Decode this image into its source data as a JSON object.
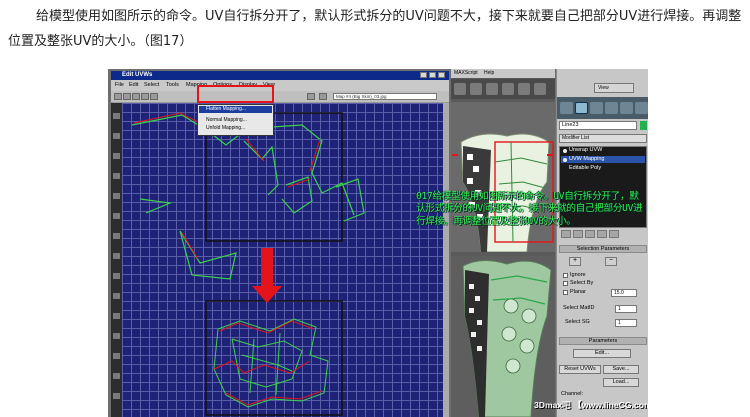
{
  "article": {
    "paragraph": "给模型使用如图所示的命令。UV自行拆分开了，默认形式拆分的UV问题不大，接下来就要自己把部分UV进行焊接。再调整位置及整张UV的大小。（图17）"
  },
  "uv_editor": {
    "title": "Edit UVWs",
    "menu": [
      "File",
      "Edit",
      "Select",
      "Tools",
      "Mapping",
      "Options",
      "Display",
      "View"
    ],
    "map_combo": "Map #4 (Big Skin)_03.jpg",
    "mapping_menu": {
      "items": [
        "Flatten Mapping...",
        "Normal Mapping...",
        "Unfold Mapping..."
      ],
      "selected": "Flatten Mapping..."
    }
  },
  "viewport": {
    "menu": [
      "MAXScript",
      "Help"
    ]
  },
  "command_panel": {
    "view_label": "View",
    "object_name": "Line23",
    "modifier_list": "Modifier List",
    "stack": [
      "Unwrap UVW",
      "UVW Mapping",
      "Editable Poly"
    ],
    "selection_rollout": "Selection Parameters",
    "ignore_label": "Ignore",
    "select_by_label": "Select By",
    "planar_label": "Planar",
    "planar_value": "15.0",
    "select_matid_label": "Select MatID",
    "select_matid_value": "1",
    "select_sg_label": "Select SG",
    "select_sg_value": "1",
    "parameters_rollout": "Parameters",
    "edit_button": "Edit...",
    "reset_uvws_button": "Reset UVWs",
    "save_button": "Save...",
    "load_button": "Load...",
    "channel_label": "Channel:"
  },
  "overlay_text": "017给模型使用如图所示的命令。UV自行拆分开了，默认形式拆分的UV问题不大。接下来就的自己把部分UV进行焊接。再调整位置及整张UV的大小。",
  "watermark": "3Dmax吧 【www.lineCG.com/tieba/1771】",
  "colors": {
    "grid_bg": "#1e2378",
    "highlight": "#e5141a",
    "arrow": "#e5141a",
    "overlay_text": "#2ef04f"
  }
}
